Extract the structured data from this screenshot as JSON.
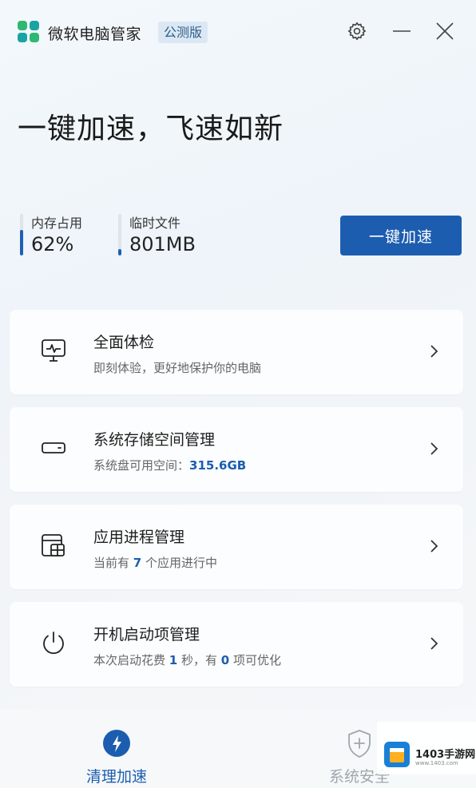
{
  "app": {
    "name": "微软电脑管家",
    "badge": "公测版"
  },
  "window_controls": {
    "settings_icon": "gear-icon",
    "minimize_icon": "minimize-icon",
    "close_icon": "close-icon"
  },
  "hero": {
    "headline": "一键加速，飞速如新"
  },
  "stats": [
    {
      "label": "内存占用",
      "value": "62%",
      "level": 0.62
    },
    {
      "label": "临时文件",
      "value": "801MB",
      "level": 0.15
    }
  ],
  "boost_button": {
    "label": "一键加速"
  },
  "cards": [
    {
      "title": "全面体检",
      "sub_parts": [
        "即刻体验，更好地保护你的电脑"
      ],
      "icon": "health-check-icon"
    },
    {
      "title": "系统存储空间管理",
      "sub_parts": [
        "系统盘可用空间：",
        "315.6GB"
      ],
      "icon": "storage-icon"
    },
    {
      "title": "应用进程管理",
      "sub_parts": [
        "当前有 ",
        "7",
        " 个应用进行中"
      ],
      "icon": "process-icon"
    },
    {
      "title": "开机启动项管理",
      "sub_parts": [
        "本次启动花费 ",
        "1",
        " 秒，有 ",
        "0",
        " 项可优化"
      ],
      "icon": "power-icon"
    }
  ],
  "bottom_nav": [
    {
      "label": "清理加速",
      "icon": "lightning-icon",
      "active": true
    },
    {
      "label": "系统安全",
      "icon": "shield-icon",
      "active": false
    }
  ],
  "watermark": {
    "name": "1403手游网",
    "url": "www.1403.com"
  },
  "colors": {
    "accent": "#1c5db0",
    "logo_green": "#2eb872",
    "logo_teal": "#1aa3a3"
  }
}
